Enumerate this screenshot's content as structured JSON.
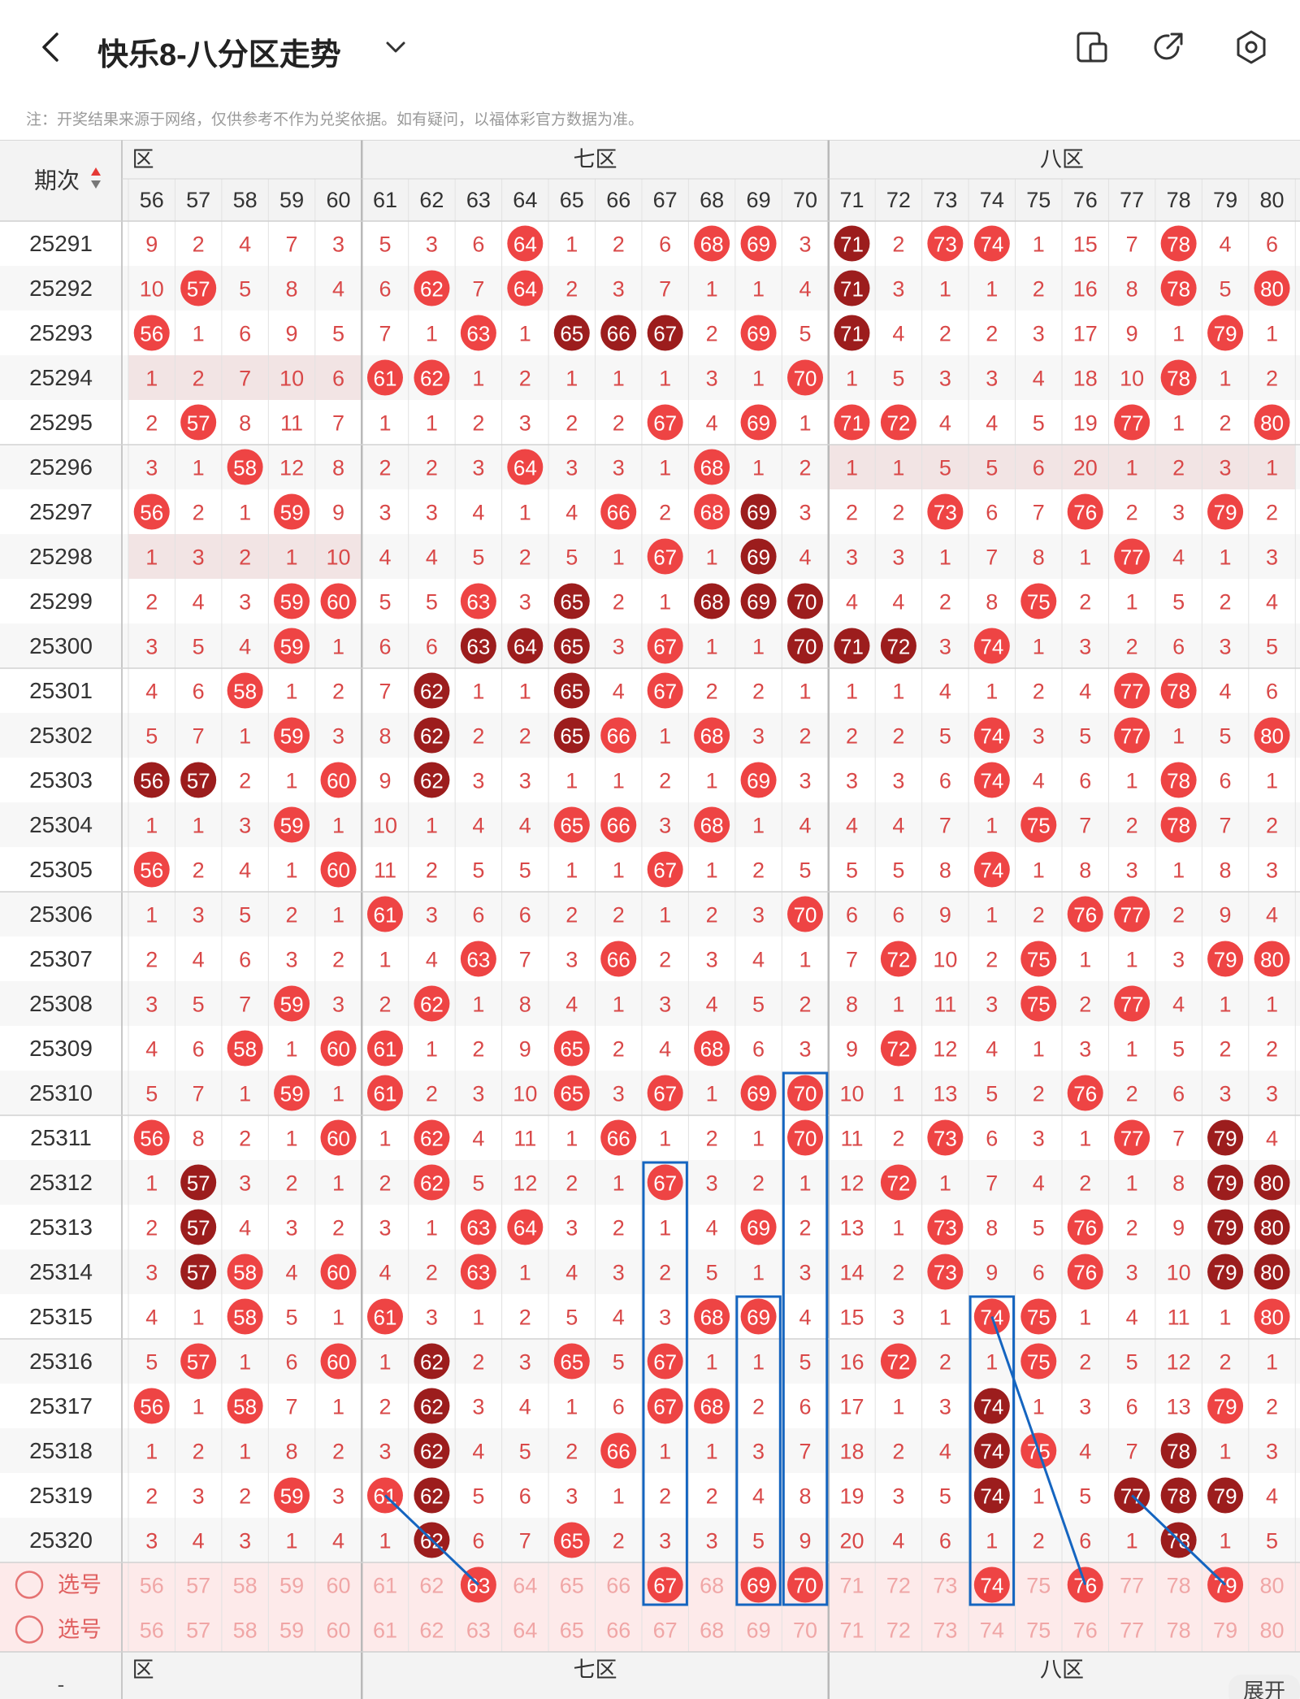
{
  "header": {
    "title": "快乐8-八分区走势",
    "note": "注：开奖结果来源于网络，仅供参考不作为兑奖依据。如有疑问，以福体彩官方数据为准。",
    "icons": [
      "back-icon",
      "chevron-down-icon",
      "device-icon",
      "share-icon",
      "settings-icon"
    ]
  },
  "table": {
    "period_header": "期次",
    "zones": [
      {
        "label": "六区",
        "shown": "六区",
        "partial": true
      },
      {
        "label": "七区"
      },
      {
        "label": "八区"
      }
    ],
    "columns": [
      56,
      57,
      58,
      59,
      60,
      61,
      62,
      63,
      64,
      65,
      66,
      67,
      68,
      69,
      70,
      71,
      72,
      73,
      74,
      75,
      76,
      77,
      78,
      79,
      80
    ],
    "rows": [
      {
        "p": "25291",
        "v": [
          9,
          2,
          4,
          7,
          3,
          5,
          3,
          6,
          64,
          1,
          2,
          6,
          68,
          69,
          3,
          71,
          2,
          73,
          74,
          1,
          15,
          7,
          78,
          4,
          6
        ],
        "dark": [
          71
        ]
      },
      {
        "p": "25292",
        "v": [
          10,
          57,
          5,
          8,
          4,
          6,
          62,
          7,
          64,
          2,
          3,
          7,
          1,
          1,
          4,
          71,
          3,
          1,
          1,
          2,
          16,
          8,
          78,
          5,
          80
        ],
        "dark": [
          71
        ]
      },
      {
        "p": "25293",
        "v": [
          56,
          1,
          6,
          9,
          5,
          7,
          1,
          63,
          1,
          65,
          66,
          67,
          2,
          69,
          5,
          71,
          4,
          2,
          2,
          3,
          17,
          9,
          1,
          79,
          1
        ],
        "dark": [
          65,
          66,
          67,
          71
        ]
      },
      {
        "p": "25294",
        "v": [
          1,
          2,
          7,
          10,
          6,
          61,
          62,
          1,
          2,
          1,
          1,
          1,
          3,
          1,
          70,
          1,
          5,
          3,
          3,
          4,
          18,
          10,
          78,
          1,
          2
        ],
        "dark": []
      },
      {
        "p": "25295",
        "v": [
          2,
          57,
          8,
          11,
          7,
          1,
          1,
          2,
          3,
          2,
          2,
          67,
          4,
          69,
          1,
          71,
          72,
          4,
          4,
          5,
          19,
          77,
          1,
          2,
          80
        ],
        "dark": []
      },
      {
        "p": "25296",
        "v": [
          3,
          1,
          58,
          12,
          8,
          2,
          2,
          3,
          64,
          3,
          3,
          1,
          68,
          1,
          2,
          1,
          1,
          5,
          5,
          6,
          20,
          1,
          2,
          3,
          1
        ],
        "dark": []
      },
      {
        "p": "25297",
        "v": [
          56,
          2,
          1,
          59,
          9,
          3,
          3,
          4,
          1,
          4,
          66,
          2,
          68,
          69,
          3,
          2,
          2,
          73,
          6,
          7,
          76,
          2,
          3,
          79,
          2
        ],
        "dark": [
          69
        ]
      },
      {
        "p": "25298",
        "v": [
          1,
          3,
          2,
          1,
          10,
          4,
          4,
          5,
          2,
          5,
          1,
          67,
          1,
          69,
          4,
          3,
          3,
          1,
          7,
          8,
          1,
          77,
          4,
          1,
          3
        ],
        "dark": [
          69
        ]
      },
      {
        "p": "25299",
        "v": [
          2,
          4,
          3,
          59,
          60,
          5,
          5,
          63,
          3,
          65,
          2,
          1,
          68,
          69,
          70,
          4,
          4,
          2,
          8,
          75,
          2,
          1,
          5,
          2,
          4
        ],
        "dark": [
          65,
          68,
          69,
          70
        ]
      },
      {
        "p": "25300",
        "v": [
          3,
          5,
          4,
          59,
          1,
          6,
          6,
          63,
          64,
          65,
          3,
          67,
          1,
          1,
          70,
          71,
          72,
          3,
          74,
          1,
          3,
          2,
          6,
          3,
          5
        ],
        "dark": [
          63,
          64,
          65,
          70,
          71,
          72
        ]
      },
      {
        "p": "25301",
        "v": [
          4,
          6,
          58,
          1,
          2,
          7,
          62,
          1,
          1,
          65,
          4,
          67,
          2,
          2,
          1,
          1,
          1,
          4,
          1,
          2,
          4,
          77,
          78,
          4,
          6
        ],
        "dark": [
          62,
          65
        ]
      },
      {
        "p": "25302",
        "v": [
          5,
          7,
          1,
          59,
          3,
          8,
          62,
          2,
          2,
          65,
          66,
          1,
          68,
          3,
          2,
          2,
          2,
          5,
          74,
          3,
          5,
          77,
          1,
          5,
          80
        ],
        "dark": [
          62,
          65
        ]
      },
      {
        "p": "25303",
        "v": [
          56,
          57,
          2,
          1,
          60,
          9,
          62,
          3,
          3,
          1,
          1,
          2,
          1,
          69,
          3,
          3,
          3,
          6,
          74,
          4,
          6,
          1,
          78,
          6,
          1
        ],
        "dark": [
          56,
          57,
          62
        ]
      },
      {
        "p": "25304",
        "v": [
          1,
          1,
          3,
          59,
          1,
          10,
          1,
          4,
          4,
          65,
          66,
          3,
          68,
          1,
          4,
          4,
          4,
          7,
          1,
          75,
          7,
          2,
          78,
          7,
          2
        ],
        "dark": []
      },
      {
        "p": "25305",
        "v": [
          56,
          2,
          4,
          1,
          60,
          11,
          2,
          5,
          5,
          1,
          1,
          67,
          1,
          2,
          5,
          5,
          5,
          8,
          74,
          1,
          8,
          3,
          1,
          8,
          3
        ],
        "dark": []
      },
      {
        "p": "25306",
        "v": [
          1,
          3,
          5,
          2,
          1,
          61,
          3,
          6,
          6,
          2,
          2,
          1,
          2,
          3,
          70,
          6,
          6,
          9,
          1,
          2,
          76,
          77,
          2,
          9,
          4
        ],
        "dark": []
      },
      {
        "p": "25307",
        "v": [
          2,
          4,
          6,
          3,
          2,
          1,
          4,
          63,
          7,
          3,
          66,
          2,
          3,
          4,
          1,
          7,
          72,
          10,
          2,
          75,
          1,
          1,
          3,
          79,
          80
        ],
        "dark": []
      },
      {
        "p": "25308",
        "v": [
          3,
          5,
          7,
          59,
          3,
          2,
          62,
          1,
          8,
          4,
          1,
          3,
          4,
          5,
          2,
          8,
          1,
          11,
          3,
          75,
          2,
          77,
          4,
          1,
          1
        ],
        "dark": []
      },
      {
        "p": "25309",
        "v": [
          4,
          6,
          58,
          1,
          60,
          61,
          1,
          2,
          9,
          65,
          2,
          4,
          68,
          6,
          3,
          9,
          72,
          12,
          4,
          1,
          3,
          1,
          5,
          2,
          2
        ],
        "dark": []
      },
      {
        "p": "25310",
        "v": [
          5,
          7,
          1,
          59,
          1,
          61,
          2,
          3,
          10,
          65,
          3,
          67,
          1,
          69,
          70,
          10,
          1,
          13,
          5,
          2,
          76,
          2,
          6,
          3,
          3
        ],
        "dark": []
      },
      {
        "p": "25311",
        "v": [
          56,
          8,
          2,
          1,
          60,
          1,
          62,
          4,
          11,
          1,
          66,
          1,
          2,
          1,
          70,
          11,
          2,
          73,
          6,
          3,
          1,
          77,
          7,
          79,
          4
        ],
        "dark": [
          79
        ]
      },
      {
        "p": "25312",
        "v": [
          1,
          57,
          3,
          2,
          1,
          2,
          62,
          5,
          12,
          2,
          1,
          67,
          3,
          2,
          1,
          12,
          72,
          1,
          7,
          4,
          2,
          1,
          8,
          79,
          80
        ],
        "dark": [
          57,
          79,
          80
        ]
      },
      {
        "p": "25313",
        "v": [
          2,
          57,
          4,
          3,
          2,
          3,
          1,
          63,
          64,
          3,
          2,
          1,
          4,
          69,
          2,
          13,
          1,
          73,
          8,
          5,
          76,
          2,
          9,
          79,
          80
        ],
        "dark": [
          57,
          79,
          80
        ]
      },
      {
        "p": "25314",
        "v": [
          3,
          57,
          58,
          4,
          60,
          4,
          2,
          63,
          1,
          4,
          3,
          2,
          5,
          1,
          3,
          14,
          2,
          73,
          9,
          6,
          76,
          3,
          10,
          79,
          80
        ],
        "dark": [
          57,
          79,
          80
        ]
      },
      {
        "p": "25315",
        "v": [
          4,
          1,
          58,
          5,
          1,
          61,
          3,
          1,
          2,
          5,
          4,
          3,
          68,
          69,
          4,
          15,
          3,
          1,
          74,
          75,
          1,
          4,
          11,
          1,
          80
        ],
        "dark": []
      },
      {
        "p": "25316",
        "v": [
          5,
          57,
          1,
          6,
          60,
          1,
          62,
          2,
          3,
          65,
          5,
          67,
          1,
          1,
          5,
          16,
          72,
          2,
          1,
          75,
          2,
          5,
          12,
          2,
          1
        ],
        "dark": [
          62
        ]
      },
      {
        "p": "25317",
        "v": [
          56,
          1,
          58,
          7,
          1,
          2,
          62,
          3,
          4,
          1,
          6,
          67,
          68,
          2,
          6,
          17,
          1,
          3,
          74,
          1,
          3,
          6,
          13,
          79,
          2
        ],
        "dark": [
          62,
          74
        ]
      },
      {
        "p": "25318",
        "v": [
          1,
          2,
          1,
          8,
          2,
          3,
          62,
          4,
          5,
          2,
          66,
          1,
          1,
          3,
          7,
          18,
          2,
          4,
          74,
          75,
          4,
          7,
          78,
          1,
          3
        ],
        "dark": [
          62,
          74,
          78
        ]
      },
      {
        "p": "25319",
        "v": [
          2,
          3,
          2,
          59,
          3,
          61,
          62,
          5,
          6,
          3,
          1,
          2,
          2,
          4,
          8,
          19,
          3,
          5,
          74,
          1,
          5,
          77,
          78,
          79,
          4
        ],
        "dark": [
          62,
          74,
          77,
          78,
          79
        ]
      },
      {
        "p": "25320",
        "v": [
          3,
          4,
          3,
          1,
          4,
          1,
          62,
          6,
          7,
          65,
          2,
          3,
          3,
          5,
          9,
          20,
          4,
          6,
          1,
          2,
          6,
          1,
          78,
          1,
          5
        ],
        "dark": [
          62,
          78
        ]
      }
    ],
    "select_rows": [
      {
        "label": "选号",
        "picked": [
          63,
          67,
          69,
          70,
          74,
          76,
          79
        ]
      },
      {
        "label": "选号",
        "picked": []
      }
    ],
    "expand_label": "展开"
  },
  "colors": {
    "ball_red": "#ee4444",
    "ball_dark": "#9c1d1d",
    "miss_text": "#d94848",
    "box_blue": "#1565c0"
  }
}
